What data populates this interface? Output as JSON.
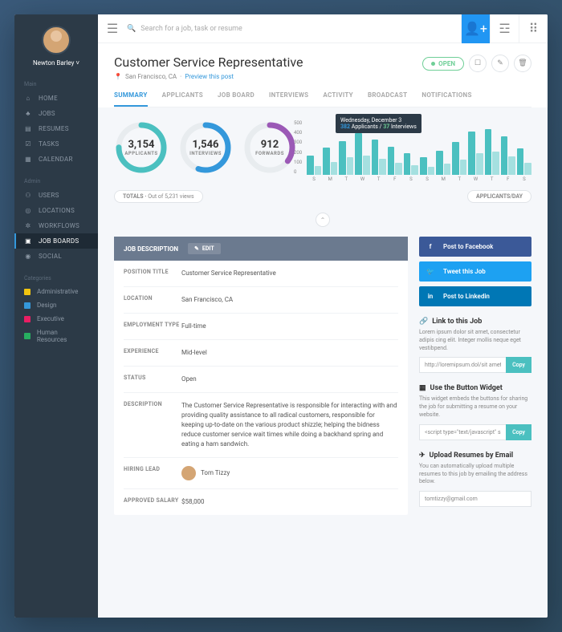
{
  "user": {
    "name": "Newton Barley"
  },
  "nav": {
    "main_header": "Main",
    "main": [
      {
        "icon": "⌂",
        "label": "HOME"
      },
      {
        "icon": "♣",
        "label": "JOBS"
      },
      {
        "icon": "▤",
        "label": "RESUMES"
      },
      {
        "icon": "☑",
        "label": "TASKS"
      },
      {
        "icon": "▦",
        "label": "CALENDAR"
      }
    ],
    "admin_header": "Admin",
    "admin": [
      {
        "icon": "⚇",
        "label": "USERS"
      },
      {
        "icon": "◎",
        "label": "LOCATIONS"
      },
      {
        "icon": "✲",
        "label": "WORKFLOWS"
      },
      {
        "icon": "▣",
        "label": "JOB BOARDS"
      },
      {
        "icon": "◉",
        "label": "SOCIAL"
      }
    ],
    "cat_header": "Categories",
    "categories": [
      {
        "color": "#f1c40f",
        "label": "Administrative"
      },
      {
        "color": "#3498db",
        "label": "Design"
      },
      {
        "color": "#e91e63",
        "label": "Executive"
      },
      {
        "color": "#27ae60",
        "label": "Human Resources"
      }
    ]
  },
  "search": {
    "placeholder": "Search for a job, task or resume"
  },
  "page": {
    "title": "Customer Service Representative",
    "location": "San Francisco, CA",
    "preview": "Preview this post",
    "status_badge": "OPEN"
  },
  "tabs": [
    "SUMMARY",
    "APPLICANTS",
    "JOB BOARD",
    "INTERVIEWS",
    "ACTIVITY",
    "BROADCAST",
    "NOTIFICATIONS"
  ],
  "stats": {
    "applicants": {
      "value": "3,154",
      "label": "APPLICANTS",
      "color": "#4bc0c0",
      "pct": 75
    },
    "interviews": {
      "value": "1,546",
      "label": "INTERVIEWS",
      "color": "#3498db",
      "pct": 55
    },
    "forwards": {
      "value": "912",
      "label": "FORWARDS",
      "color": "#9b59b6",
      "pct": 35
    }
  },
  "totals": {
    "label": "TOTALS",
    "sub": "Out of 5,231 views"
  },
  "chart": {
    "badge": "APPLICANTS/DAY"
  },
  "chart_data": {
    "type": "bar",
    "title": "Applicants/Day",
    "ylabel": "",
    "ylim": [
      0,
      500
    ],
    "yticks": [
      0,
      100,
      200,
      300,
      400,
      500
    ],
    "categories": [
      "S",
      "M",
      "T",
      "W",
      "T",
      "F",
      "S",
      "S",
      "M",
      "T",
      "W",
      "T",
      "F",
      "S"
    ],
    "series": [
      {
        "name": "Applicants",
        "values": [
          180,
          250,
          310,
          382,
          320,
          260,
          200,
          160,
          220,
          300,
          400,
          420,
          350,
          240
        ]
      },
      {
        "name": "Interviews",
        "values": [
          80,
          120,
          160,
          180,
          150,
          110,
          90,
          70,
          100,
          140,
          200,
          210,
          170,
          110
        ]
      }
    ],
    "tooltip": {
      "date": "Wednesday, December 3",
      "applicants": 382,
      "interviews": 37
    }
  },
  "job": {
    "header": "JOB DESCRIPTION",
    "edit": "EDIT",
    "fields": {
      "position_title": {
        "label": "POSITION TITLE",
        "value": "Customer Service Representative"
      },
      "location": {
        "label": "LOCATION",
        "value": "San Francisco, CA"
      },
      "employment_type": {
        "label": "EMPLOYMENT TYPE",
        "value": "Full-time"
      },
      "experience": {
        "label": "EXPERIENCE",
        "value": "Mid-level"
      },
      "status": {
        "label": "STATUS",
        "value": "Open"
      },
      "description": {
        "label": "DESCRIPTION",
        "value": "The Customer Service Representative is responsible for interacting with and providing quality assistance to all radical customers, responsible for keeping up-to-date on the various product shizzle; helping the bidness reduce customer service wait times while doing a backhand spring and eating a ham sandwich."
      },
      "hiring_lead": {
        "label": "HIRING LEAD",
        "value": "Tom Tizzy"
      },
      "approved_salary": {
        "label": "APPROVED SALARY",
        "value": "$58,000"
      }
    }
  },
  "share": {
    "facebook": "Post to Facebook",
    "twitter": "Tweet this Job",
    "linkedin": "Post to Linkedin"
  },
  "widgets": {
    "link": {
      "title": "Link to this Job",
      "desc": "Lorem ipsum dolor sit amet, consectetur adipis cing elit. Integer mollis neque eget vestibpend.",
      "value": "http://loremipsum.dol/sit amet...",
      "copy": "Copy"
    },
    "button": {
      "title": "Use the Button Widget",
      "desc": "This widget embeds the buttons for sharing the job for submitting a resume on your website.",
      "value": "<script type=\"text/javascript\" s...",
      "copy": "Copy"
    },
    "email": {
      "title": "Upload Resumes by Email",
      "desc": "You can automatically upload multiple resumes to this job by emailing the address below.",
      "value": "tomtizzy@gmail.com"
    }
  }
}
